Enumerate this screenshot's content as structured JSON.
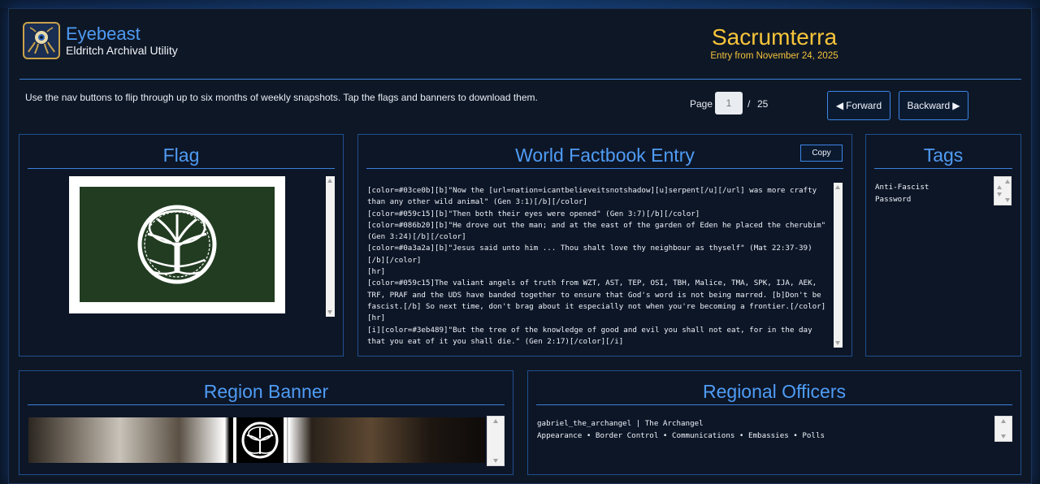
{
  "app": {
    "title": "Eyebeast",
    "subtitle": "Eldritch Archival Utility",
    "logo_icon": "eye-tentacle-icon"
  },
  "nation": {
    "name": "Sacrumterra",
    "entry_date": "Entry from November 24, 2025"
  },
  "hint": "Use the nav buttons to flip through up to six months of weekly snapshots. Tap the flags and banners to download them.",
  "pager": {
    "label": "Page",
    "placeholder": "1",
    "separator": "/",
    "total": "25"
  },
  "nav": {
    "forward_label": "Forward",
    "backward_label": "Backward"
  },
  "flag": {
    "title": "Flag",
    "colors": {
      "field": "#223c22",
      "border": "#ffffff",
      "emblem": "#ffffff"
    }
  },
  "factbook": {
    "title": "World Factbook Entry",
    "copy_label": "Copy",
    "lines": [
      "[color=#03ce0b][b]\"Now the [url=nation=icantbelieveitsnotshadow][u]serpent[/u][/url] was more crafty than any other wild animal\" (Gen 3:1)[/b][/color]",
      "[color=#059c15][b]\"Then both their eyes were opened\" (Gen 3:7)[/b][/color]",
      "[color=#086b20][b]\"He drove out the man; and at the east of the garden of Eden he placed the cherubim\" (Gen 3:24)[/b][/color]",
      "[color=#0a3a2a][b]\"Jesus said unto him ... Thou shalt love thy neighbour as thyself\" (Mat 22:37-39)[/b][/color]",
      "[hr]",
      "[color=#059c15]The valiant angels of truth from WZT, AST, TEP, OSI, TBH, Malice, TMA, SPK, IJA, AEK, TRF, PRAF and the UDS have banded together to ensure that God's word is not being marred. [b]Don't be fascist.[/b] So next time, don't brag about it especially not when you're becoming a frontier.[/color]",
      "[hr]",
      "[i][color=#3eb489]\"But the tree of the knowledge of good and evil you shall not eat, for in the day that you eat of it you shall die.\" (Gen 2:17)[/color][/i]"
    ]
  },
  "tags": {
    "title": "Tags",
    "items": [
      "Anti-Fascist",
      "Password"
    ]
  },
  "banner": {
    "title": "Region Banner"
  },
  "officers": {
    "title": "Regional Officers",
    "entries": [
      {
        "line": "gabriel_the_archangel | The Archangel"
      },
      {
        "line": "Appearance • Border Control • Communications • Embassies • Polls"
      }
    ]
  },
  "colors": {
    "accent_blue": "#4f9cf5",
    "accent_gold": "#f5c43a",
    "panel_border": "#1f4f8e",
    "background": "#0e1726"
  }
}
